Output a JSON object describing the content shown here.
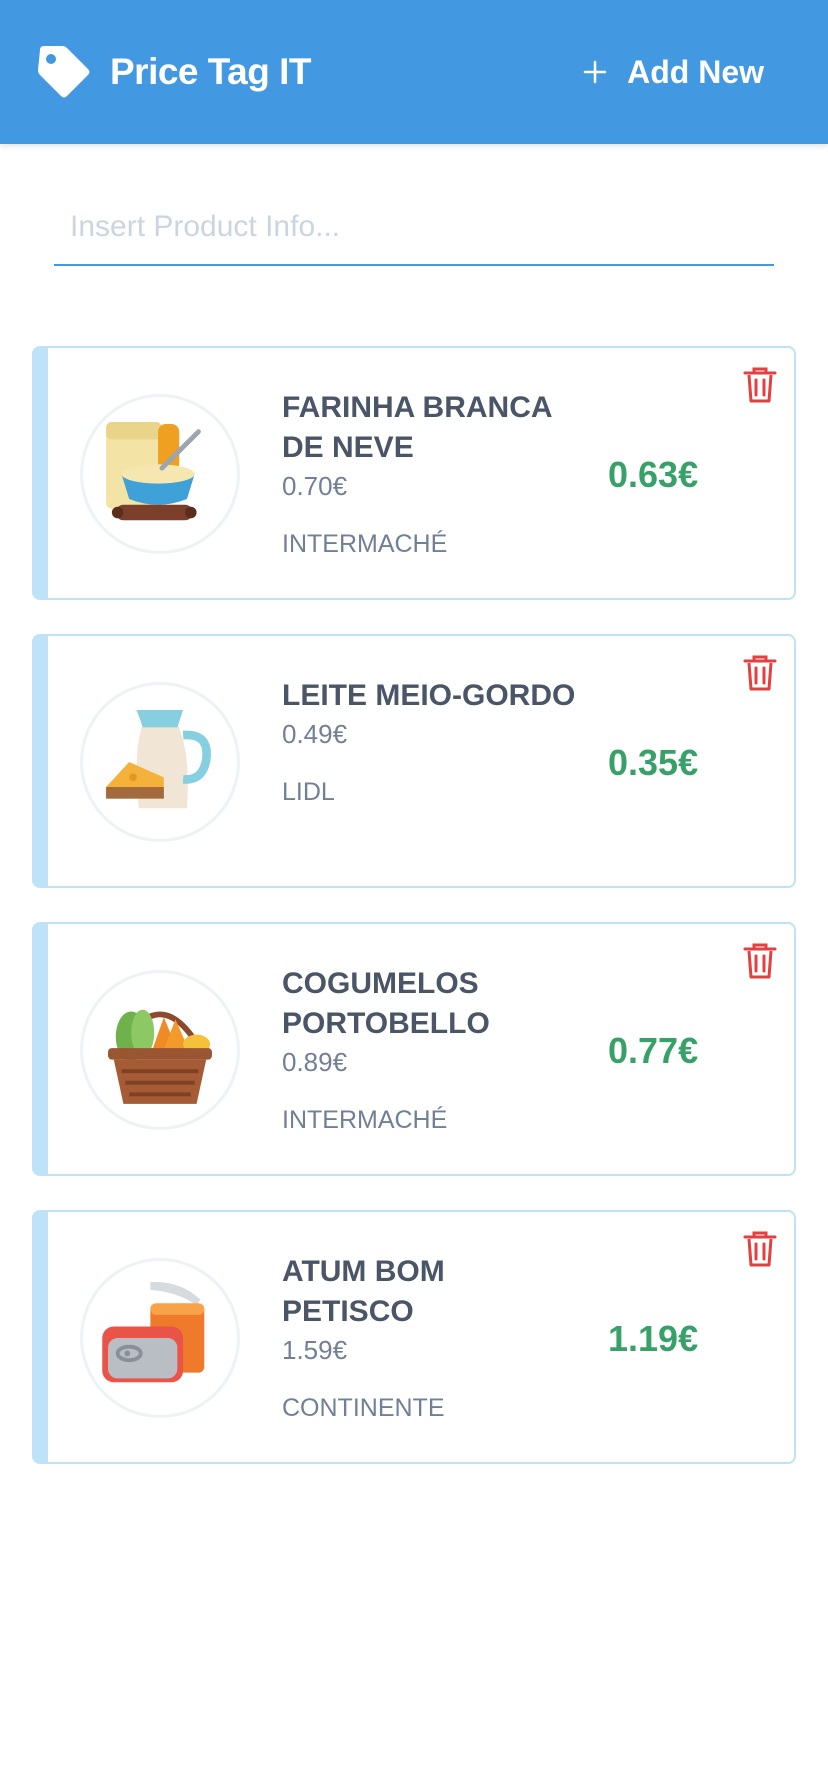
{
  "header": {
    "title": "Price Tag IT",
    "add_new_label": "Add New",
    "brand_icon": "tag-icon",
    "add_icon": "plus-icon",
    "background": "#4299e1"
  },
  "search": {
    "placeholder": "Insert Product Info...",
    "value": ""
  },
  "colors": {
    "new_price": "#38a169",
    "accent_border": "#bee3f8",
    "delete": "#e53e3e"
  },
  "products": [
    {
      "name": "FARINHA BRANCA DE NEVE",
      "old_price": "0.70€",
      "store": "INTERMACHÉ",
      "new_price": "0.63€",
      "image_icon": "baking-bowl-icon"
    },
    {
      "name": "LEITE MEIO-GORDO",
      "old_price": "0.49€",
      "store": "LIDL",
      "new_price": "0.35€",
      "image_icon": "milk-cheese-icon"
    },
    {
      "name": "COGUMELOS PORTOBELLO",
      "old_price": "0.89€",
      "store": "INTERMACHÉ",
      "new_price": "0.77€",
      "image_icon": "vegetable-basket-icon"
    },
    {
      "name": "ATUM BOM PETISCO",
      "old_price": "1.59€",
      "store": "CONTINENTE",
      "new_price": "1.19€",
      "image_icon": "canned-food-icon"
    }
  ]
}
